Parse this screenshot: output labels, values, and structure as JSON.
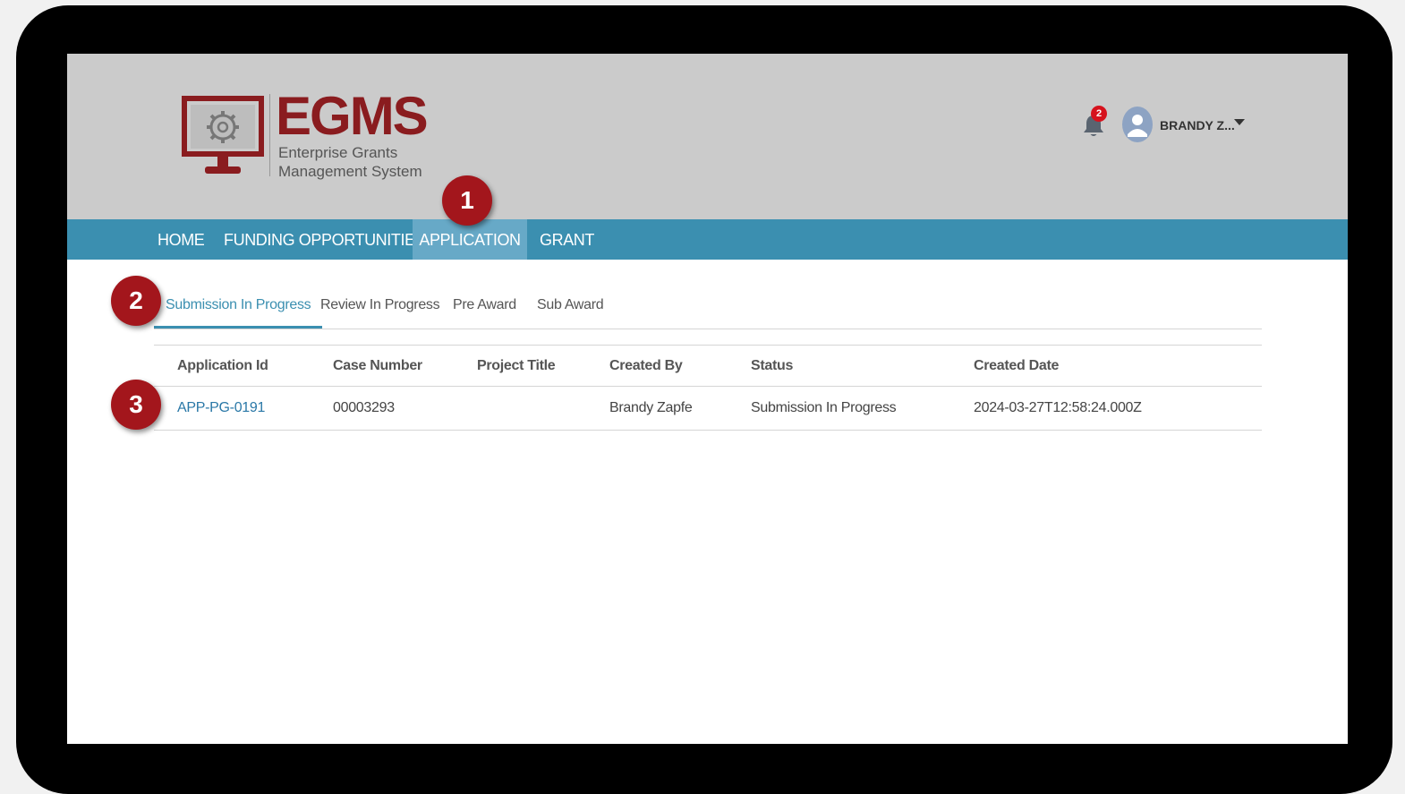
{
  "app": {
    "logo_title": "EGMS",
    "logo_subtitle_line1": "Enterprise Grants",
    "logo_subtitle_line2": "Management System"
  },
  "header": {
    "notification_count": "2",
    "user_name": "BRANDY Z...",
    "icons": {
      "bell": "bell-icon",
      "avatar": "user-avatar-icon",
      "caret": "caret-down-icon"
    }
  },
  "nav": {
    "items": [
      {
        "label": "HOME",
        "active": false
      },
      {
        "label": "FUNDING OPPORTUNITIES",
        "active": false
      },
      {
        "label": "APPLICATION",
        "active": true
      },
      {
        "label": "GRANT",
        "active": false
      }
    ]
  },
  "tabs": [
    {
      "label": "Submission In Progress",
      "active": true
    },
    {
      "label": "Review In Progress",
      "active": false
    },
    {
      "label": "Pre Award",
      "active": false
    },
    {
      "label": "Sub Award",
      "active": false
    }
  ],
  "table": {
    "headers": [
      "Application Id",
      "Case Number",
      "Project Title",
      "Created By",
      "Status",
      "Created Date"
    ],
    "rows": [
      [
        "APP-PG-0191",
        "00003293",
        "",
        "Brandy Zapfe",
        "Submission In Progress",
        "2024-03-27T12:58:24.000Z"
      ]
    ]
  },
  "markers": [
    "1",
    "2",
    "3"
  ],
  "colors": {
    "brand": "#8a1c1f",
    "nav_bar": "#3b8fb0",
    "nav_active": "#67a9c7",
    "marker": "#a3161c",
    "link": "#2a78a7",
    "badge": "#d6121d"
  }
}
